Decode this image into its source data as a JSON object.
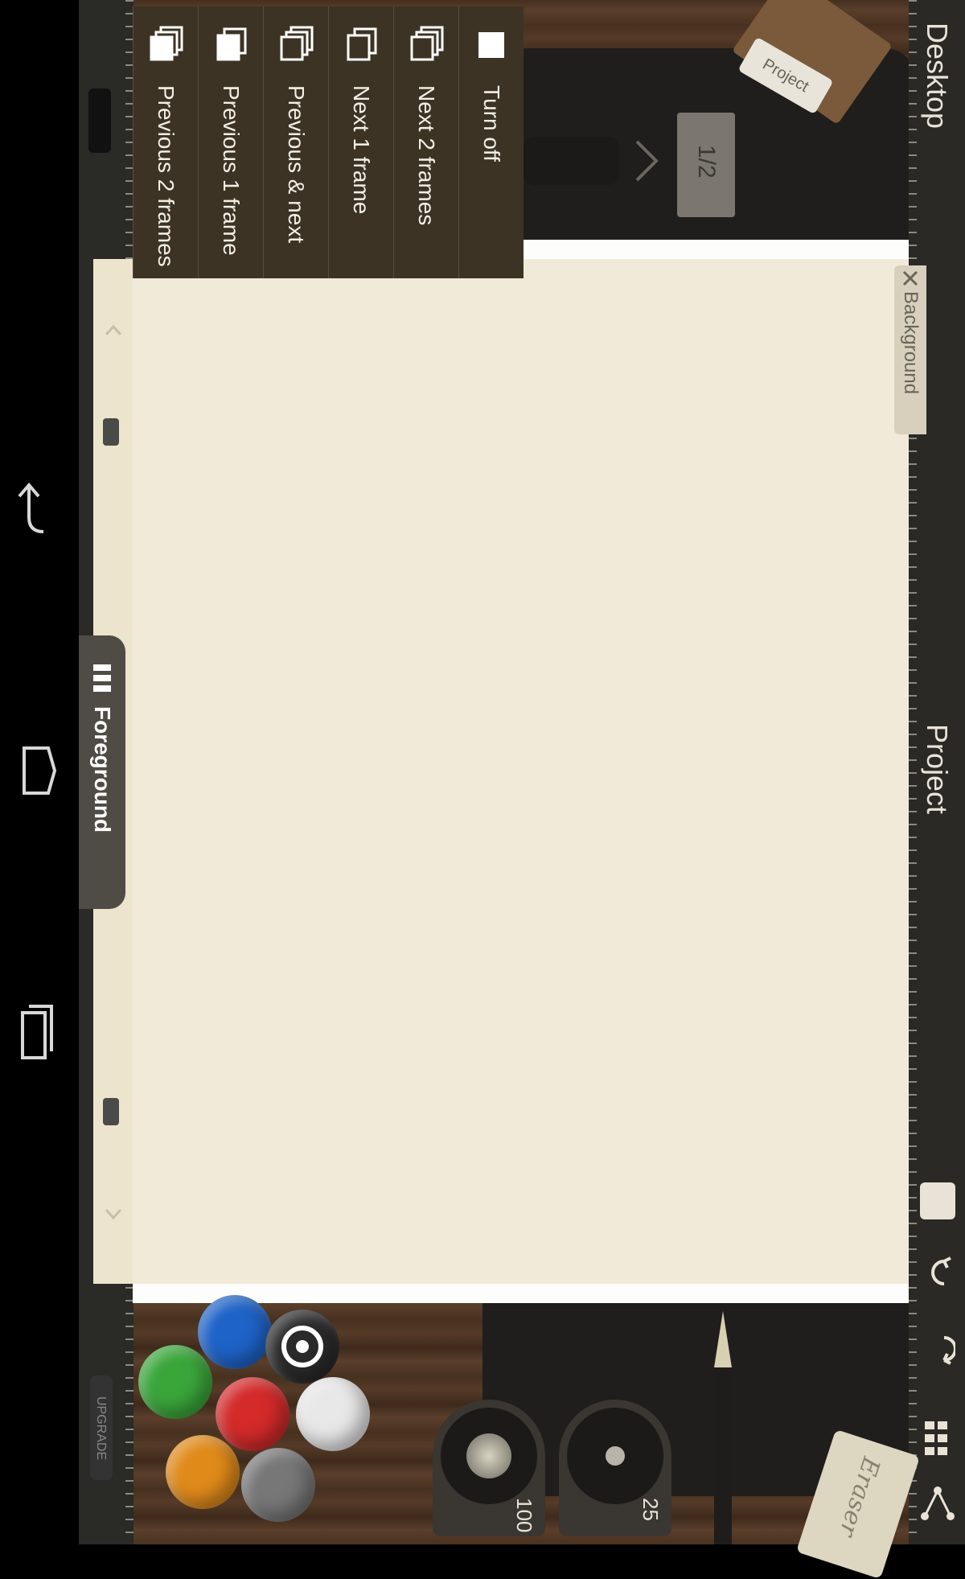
{
  "colors": {
    "menu_bg": "#3d3325",
    "paper": "#f2ead8",
    "frame": "#fdfdfb",
    "wood": "#4a3221",
    "toolbar": "#2b2925"
  },
  "topbar": {
    "desktop_label": "Desktop",
    "project_label": "Project",
    "icons": [
      "save-icon",
      "undo-icon",
      "redo-icon",
      "frames-icon",
      "share-icon"
    ]
  },
  "project_tag": "Project",
  "page_counter": "1/2",
  "layers": {
    "foreground_label": "Foreground",
    "background_label": "Background"
  },
  "onion_skin_menu": {
    "items": [
      {
        "label": "Turn off",
        "icon": "single-frame-icon"
      },
      {
        "label": "Next 2 frames",
        "icon": "stack-next-2-icon"
      },
      {
        "label": "Next 1 frame",
        "icon": "stack-next-1-icon"
      },
      {
        "label": "Previous & next",
        "icon": "stack-prev-next-icon"
      },
      {
        "label": "Previous 1 frame",
        "icon": "stack-prev-1-icon"
      },
      {
        "label": "Previous 2 frames",
        "icon": "stack-prev-2-icon"
      }
    ]
  },
  "tools": {
    "brush_size_value": "100",
    "opacity_value": "25",
    "eraser_label": "Eraser",
    "upgrade_label": "UPGRADE"
  },
  "palette": {
    "colors": [
      "#1e63c8",
      "#2a2a2a",
      "#3aa63a",
      "#d42a2a",
      "#e8e8e8",
      "#e08a1a",
      "#777777"
    ]
  },
  "system_nav": {
    "icons": [
      "back-icon",
      "home-icon",
      "recents-icon"
    ]
  }
}
